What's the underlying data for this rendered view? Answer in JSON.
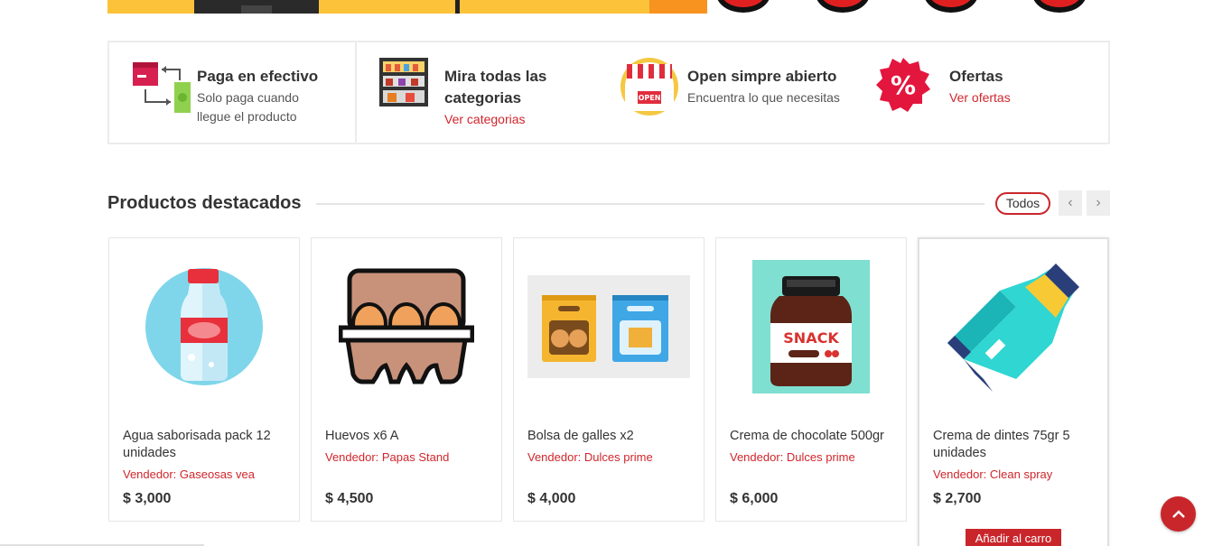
{
  "features": [
    {
      "icon": "cash-exchange-icon",
      "title": "Paga en efectivo",
      "subtitle_line1": "Solo paga cuando",
      "subtitle_line2": "llegue el producto"
    },
    {
      "icon": "store-shelves-icon",
      "title_line1": "Mira todas las",
      "title_line2": "categorias",
      "link": "Ver categorias"
    },
    {
      "icon": "open-store-icon",
      "title": "Open simpre abierto",
      "subtitle": "Encuentra lo que necesitas"
    },
    {
      "icon": "percent-badge-icon",
      "title": "Ofertas",
      "link": "Ver ofertas"
    }
  ],
  "featured": {
    "title": "Productos destacados",
    "all_button": "Todos",
    "prev_icon": "chevron-left-icon",
    "next_icon": "chevron-right-icon"
  },
  "products": [
    {
      "name": "Agua saborisada pack 12 unidades",
      "vendor": "Vendedor: Gaseosas vea",
      "price": "$ 3,000",
      "icon": "water-bottle-icon"
    },
    {
      "name": "Huevos x6 A",
      "vendor": "Vendedor: Papas Stand",
      "price": "$ 4,500",
      "icon": "egg-carton-icon"
    },
    {
      "name": "Bolsa de galles x2",
      "vendor": "Vendedor: Dulces prime",
      "price": "$ 4,000",
      "icon": "cookie-bags-icon"
    },
    {
      "name": "Crema de chocolate 500gr",
      "vendor": "Vendedor: Dulces prime",
      "price": "$ 6,000",
      "icon": "chocolate-jar-icon"
    },
    {
      "name": "Crema de dintes 75gr 5 unidades",
      "vendor": "Vendedor: Clean spray",
      "price": "$ 2,700",
      "icon": "toothpaste-tube-icon",
      "add_to_cart": "Añadir al carro"
    }
  ],
  "snack_label": "SNACK",
  "open_label": "OPEN",
  "colors": {
    "accent": "#c9262c",
    "link": "#d0262c",
    "banner": "#fcc33a"
  }
}
